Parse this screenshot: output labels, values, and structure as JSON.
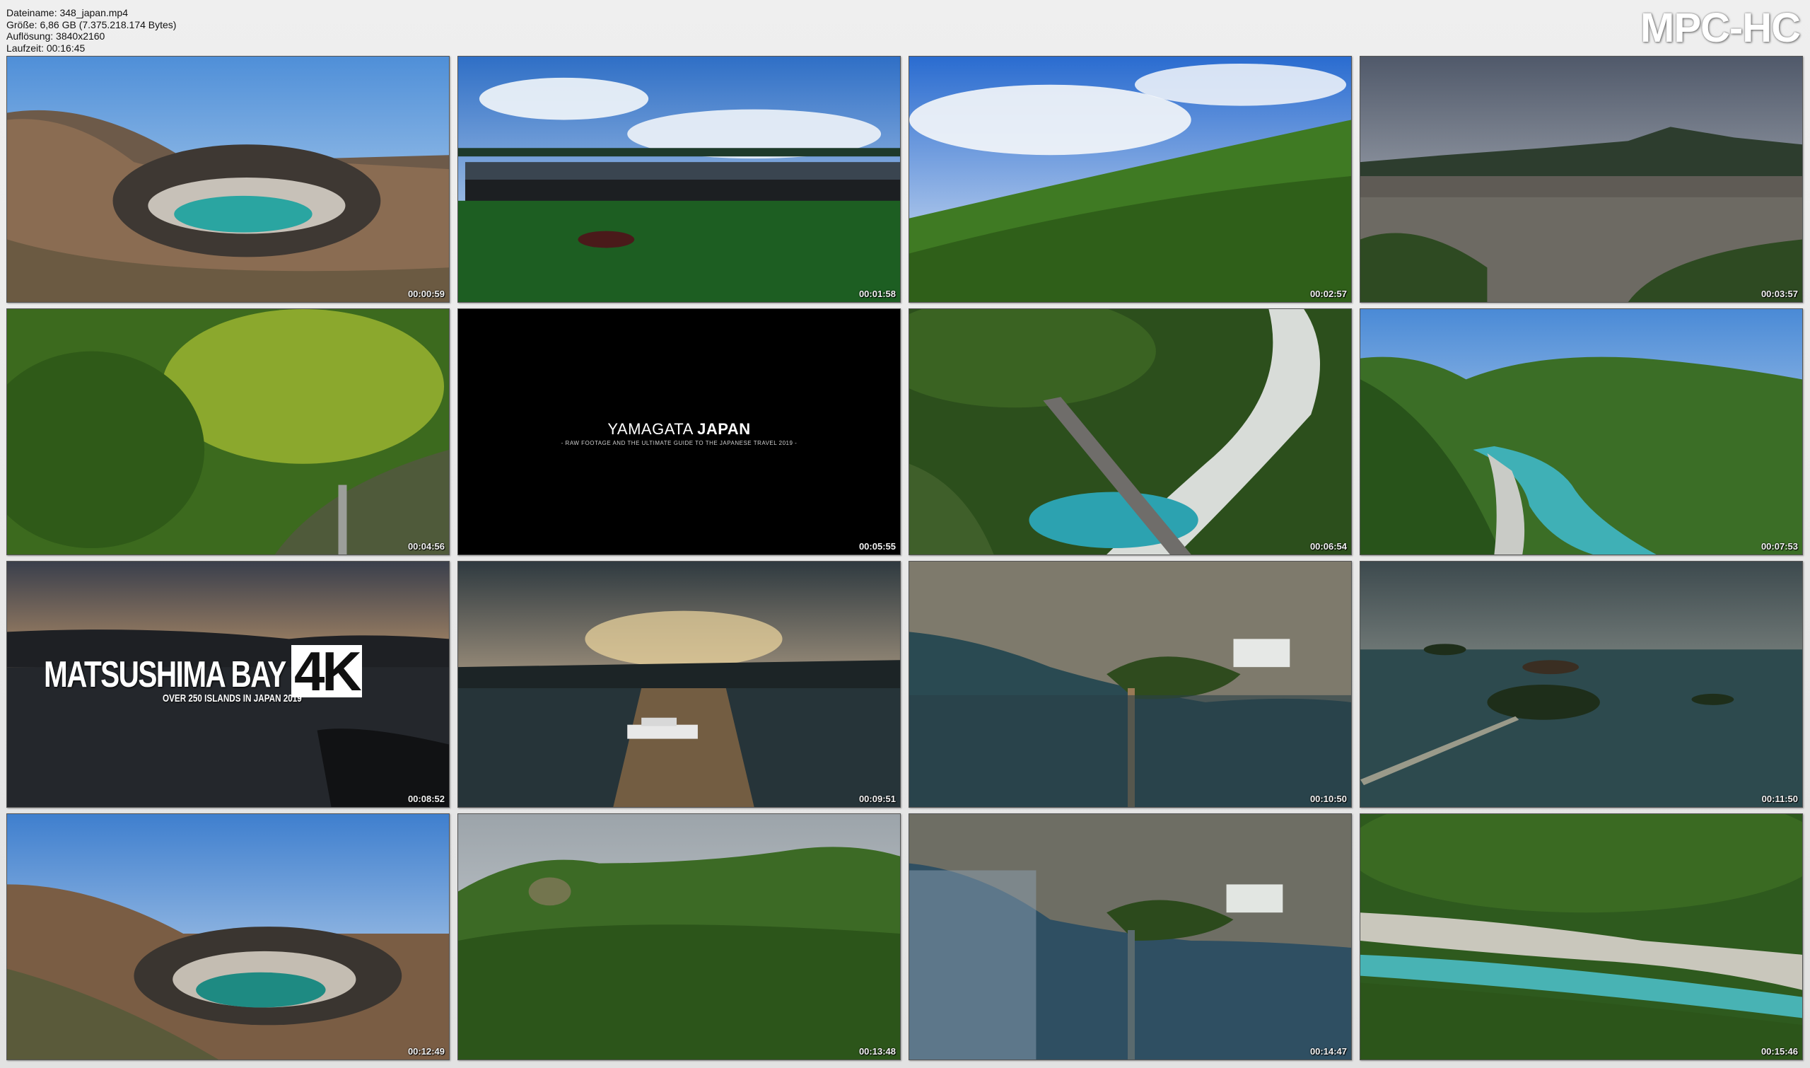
{
  "info": {
    "filename": "Dateiname: 348_japan.mp4",
    "size": "Größe: 6,86 GB (7.375.218.174 Bytes)",
    "resolution": "Auflösung: 3840x2160",
    "duration": "Laufzeit: 00:16:45"
  },
  "brand": "MPC-HC",
  "thumbs": [
    {
      "time": "00:00:59",
      "scene": "crater-lake"
    },
    {
      "time": "00:01:58",
      "scene": "lodge"
    },
    {
      "time": "00:02:57",
      "scene": "green-slope"
    },
    {
      "time": "00:03:57",
      "scene": "town"
    },
    {
      "time": "00:04:56",
      "scene": "forest-valley"
    },
    {
      "time": "00:05:55",
      "scene": "title-card"
    },
    {
      "time": "00:06:54",
      "scene": "river-bridge"
    },
    {
      "time": "00:07:53",
      "scene": "river-gorge"
    },
    {
      "time": "00:08:52",
      "scene": "matsushima-title"
    },
    {
      "time": "00:09:51",
      "scene": "sunset-boat"
    },
    {
      "time": "00:10:50",
      "scene": "coastal-town"
    },
    {
      "time": "00:11:50",
      "scene": "islands-bay"
    },
    {
      "time": "00:12:49",
      "scene": "crater-lake-2"
    },
    {
      "time": "00:13:48",
      "scene": "forest-mountain"
    },
    {
      "time": "00:14:47",
      "scene": "coastal-town-2"
    },
    {
      "time": "00:15:46",
      "scene": "river-rocks"
    }
  ],
  "title_card": {
    "title_light": "YAMAGATA ",
    "title_bold": "JAPAN",
    "subtitle": "- RAW FOOTAGE AND THE ULTIMATE GUIDE TO THE JAPANESE TRAVEL 2019 -"
  },
  "matsushima": {
    "title": "MATSUSHIMA BAY",
    "subtitle": "OVER 250 ISLANDS IN JAPAN 2019",
    "badge": "4K"
  }
}
